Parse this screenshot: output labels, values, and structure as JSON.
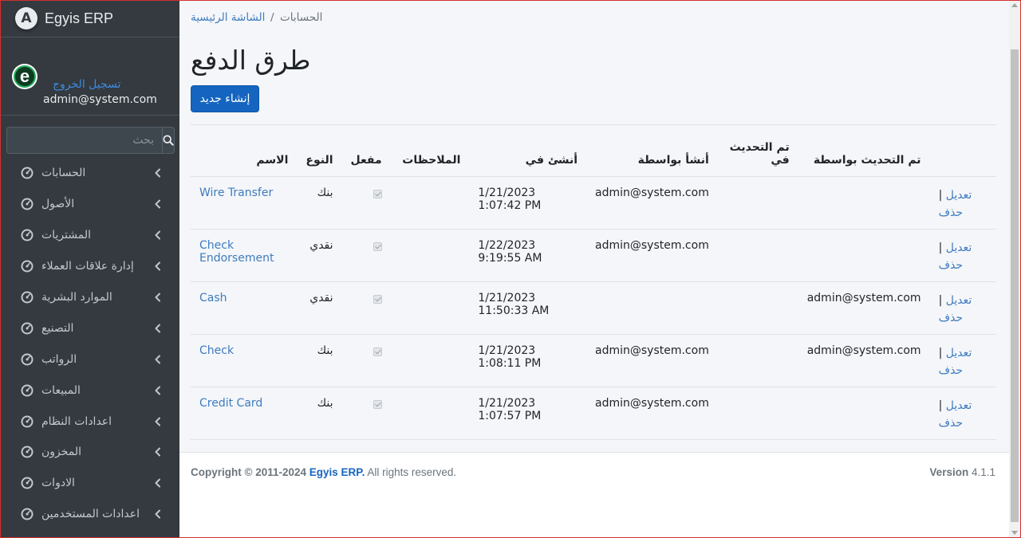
{
  "brand": {
    "logo_letter": "A",
    "name": "Egyis ERP"
  },
  "user": {
    "avatar_letter": "e",
    "email": "admin@system.com",
    "logout_label": "تسجيل الخروج"
  },
  "search": {
    "placeholder": "بحث"
  },
  "sidebar": {
    "items": [
      {
        "label": "الحسابات"
      },
      {
        "label": "الأصول"
      },
      {
        "label": "المشتريات"
      },
      {
        "label": "إدارة علاقات العملاء"
      },
      {
        "label": "الموارد البشرية"
      },
      {
        "label": "التصنيع"
      },
      {
        "label": "الرواتب"
      },
      {
        "label": "المبيعات"
      },
      {
        "label": "اعدادات النظام"
      },
      {
        "label": "المخزون"
      },
      {
        "label": "الادوات"
      },
      {
        "label": "اعدادات المستخدمين"
      }
    ]
  },
  "breadcrumb": {
    "home": "الشاشة الرئيسية",
    "separator": "/",
    "current": "الحسابات"
  },
  "page": {
    "title": "طرق الدفع",
    "create_label": "إنشاء جديد"
  },
  "table": {
    "headers": {
      "name": "الاسم",
      "type": "النوع",
      "enabled": "مفعل",
      "notes": "الملاحظات",
      "created_on": "أنشئ في",
      "created_by": "أنشأ بواسطة",
      "updated_on": "تم التحديث في",
      "updated_by": "تم التحديث بواسطة"
    },
    "edit_label": "تعديل",
    "action_separator": "|",
    "delete_label": "حذف",
    "rows": [
      {
        "name": "Wire Transfer",
        "type": "بنك",
        "enabled": true,
        "notes": "",
        "created_on": "1/21/2023 1:07:42 PM",
        "created_by": "admin@system.com",
        "updated_on": "",
        "updated_by": ""
      },
      {
        "name": "Check Endorsement",
        "type": "نقدي",
        "enabled": true,
        "notes": "",
        "created_on": "1/22/2023 9:19:55 AM",
        "created_by": "admin@system.com",
        "updated_on": "",
        "updated_by": ""
      },
      {
        "name": "Cash",
        "type": "نقدي",
        "enabled": true,
        "notes": "",
        "created_on": "1/21/2023 11:50:33 AM",
        "created_by": "",
        "updated_on": "",
        "updated_by": "admin@system.com"
      },
      {
        "name": "Check",
        "type": "بنك",
        "enabled": true,
        "notes": "",
        "created_on": "1/21/2023 1:08:11 PM",
        "created_by": "admin@system.com",
        "updated_on": "",
        "updated_by": "admin@system.com"
      },
      {
        "name": "Credit Card",
        "type": "بنك",
        "enabled": true,
        "notes": "",
        "created_on": "1/21/2023 1:07:57 PM",
        "created_by": "admin@system.com",
        "updated_on": "",
        "updated_by": ""
      }
    ]
  },
  "footer": {
    "copyright_prefix": "Copyright © 2011-2024",
    "company": "Egyis ERP.",
    "rights": "All rights reserved.",
    "version_label": "Version",
    "version_value": "4.1.1"
  },
  "colors": {
    "sidebar_bg": "#343a40",
    "primary": "#1565c0",
    "link": "#3f7bbf",
    "content_bg": "#f4f6f9"
  }
}
